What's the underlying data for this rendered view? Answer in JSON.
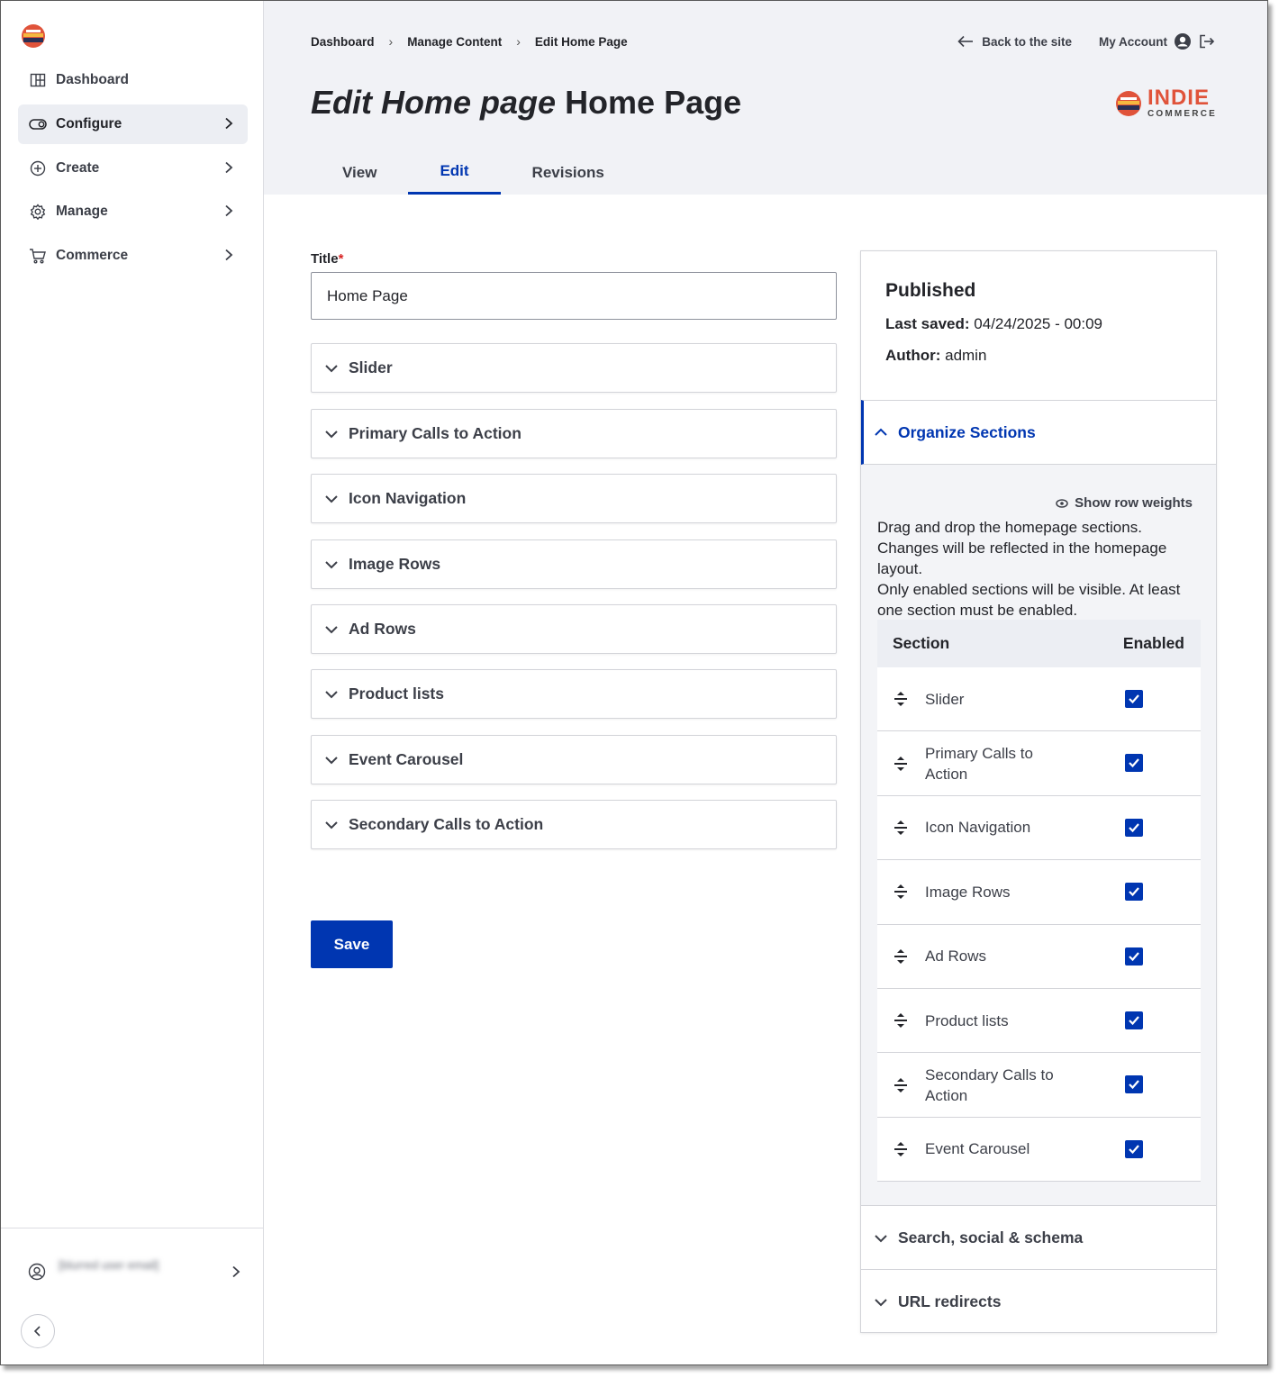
{
  "sidebar": {
    "items": [
      {
        "label": "Dashboard",
        "icon": "dashboard-icon"
      },
      {
        "label": "Configure",
        "icon": "toggle-icon",
        "active": true
      },
      {
        "label": "Create",
        "icon": "plus-circle-icon"
      },
      {
        "label": "Manage",
        "icon": "gear-icon"
      },
      {
        "label": "Commerce",
        "icon": "cart-icon"
      }
    ],
    "user_label": "[blurred user email]"
  },
  "breadcrumb": [
    "Dashboard",
    "Manage Content",
    "Edit Home Page"
  ],
  "header": {
    "back_link": "Back to the site",
    "account_link": "My Account",
    "title_italic": "Edit Home page",
    "title_rest": "Home Page",
    "brand_name": "INDIE",
    "brand_sub": "COMMERCE"
  },
  "tabs": [
    {
      "label": "View"
    },
    {
      "label": "Edit",
      "active": true
    },
    {
      "label": "Revisions"
    }
  ],
  "form": {
    "title_label": "Title",
    "title_required_marker": "*",
    "title_value": "Home Page",
    "accordions": [
      "Slider",
      "Primary Calls to Action",
      "Icon Navigation",
      "Image Rows",
      "Ad Rows",
      "Product lists",
      "Event Carousel",
      "Secondary Calls to Action"
    ],
    "save_label": "Save"
  },
  "meta": {
    "status": "Published",
    "last_saved_label": "Last saved:",
    "last_saved_value": "04/24/2025 - 00:09",
    "author_label": "Author:",
    "author_value": "admin"
  },
  "organize": {
    "heading": "Organize Sections",
    "show_weights": "Show row weights",
    "desc_line1": "Drag and drop the homepage sections. Changes will be reflected in the homepage layout.",
    "desc_line2": "Only enabled sections will be visible. At least one section must be enabled.",
    "col_section": "Section",
    "col_enabled": "Enabled",
    "rows": [
      {
        "label": "Slider",
        "enabled": true
      },
      {
        "label": "Primary Calls to Action",
        "enabled": true
      },
      {
        "label": "Icon Navigation",
        "enabled": true
      },
      {
        "label": "Image Rows",
        "enabled": true
      },
      {
        "label": "Ad Rows",
        "enabled": true
      },
      {
        "label": "Product lists",
        "enabled": true
      },
      {
        "label": "Secondary Calls to Action",
        "enabled": true
      },
      {
        "label": "Event Carousel",
        "enabled": true
      }
    ]
  },
  "collapsed_sections": [
    "Search, social & schema",
    "URL redirects"
  ],
  "colors": {
    "accent": "#0036b1",
    "header_bg": "#f1f2f6",
    "brand": "#e0533a"
  }
}
